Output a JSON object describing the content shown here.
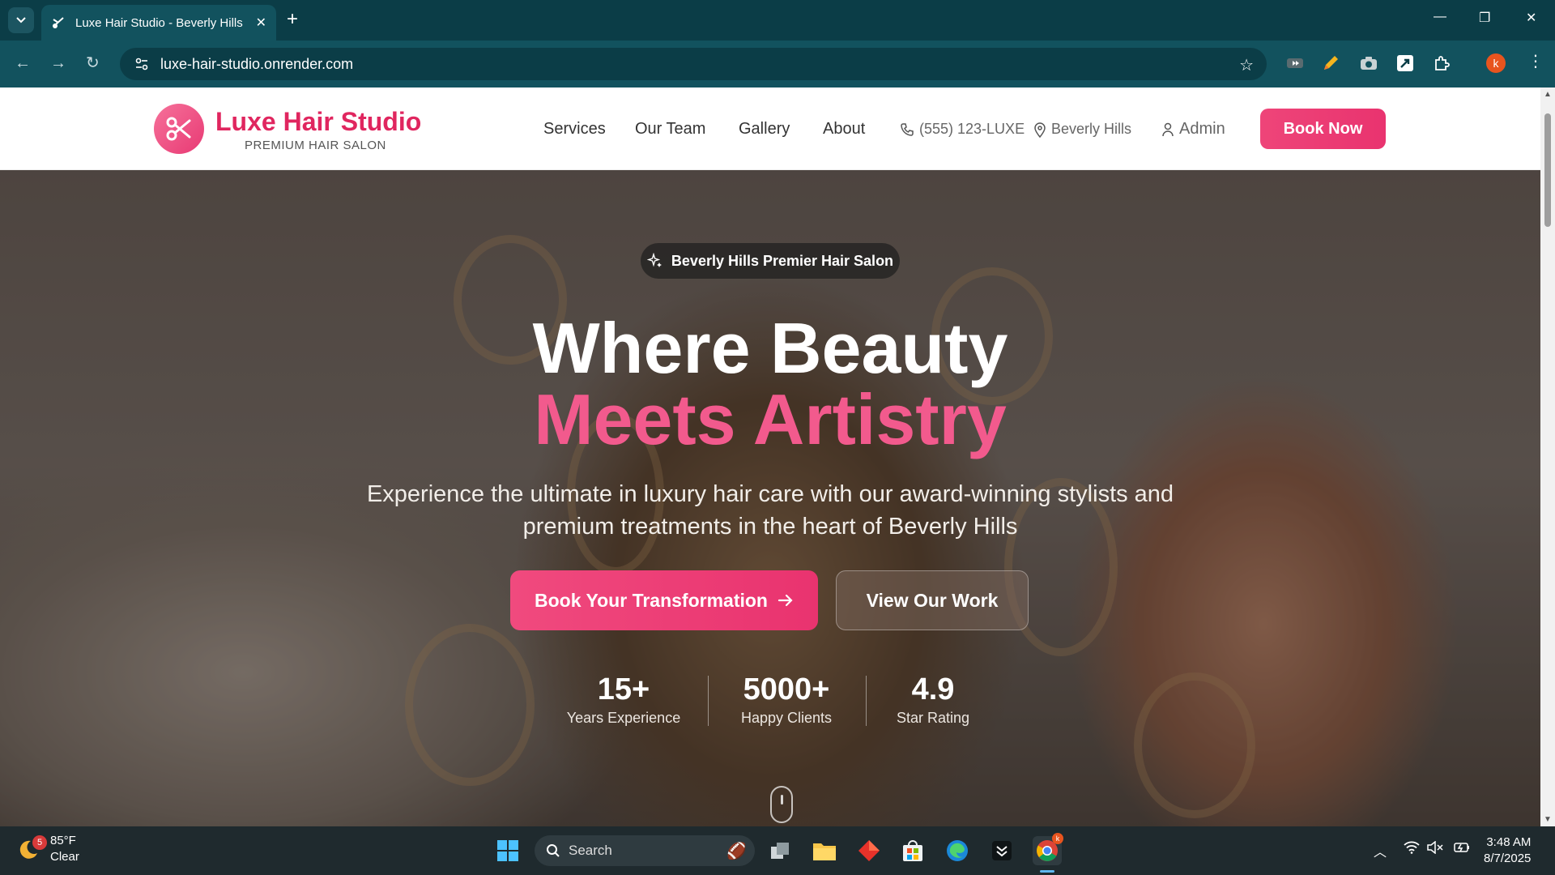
{
  "browser": {
    "tab_title": "Luxe Hair Studio - Beverly Hills",
    "url": "luxe-hair-studio.onrender.com",
    "profile_initial": "k",
    "accent": "#0b3d47"
  },
  "site": {
    "logo_name": "Luxe Hair Studio",
    "logo_tagline": "PREMIUM HAIR SALON",
    "nav": {
      "services": "Services",
      "team": "Our Team",
      "gallery": "Gallery",
      "about": "About",
      "phone": "(555) 123-LUXE",
      "location": "Beverly Hills",
      "admin": "Admin",
      "book_now": "Book Now"
    },
    "brand_color": "#e9336f"
  },
  "hero": {
    "badge": "Beverly Hills Premier Hair Salon",
    "headline_line1": "Where Beauty",
    "headline_line2": "Meets Artistry",
    "subtitle": "Experience the ultimate in luxury hair care with our award-winning stylists and premium treatments in the heart of Beverly Hills",
    "cta_primary": "Book Your Transformation",
    "cta_secondary": "View Our Work",
    "stats": [
      {
        "value": "15+",
        "label": "Years Experience"
      },
      {
        "value": "5000+",
        "label": "Happy Clients"
      },
      {
        "value": "4.9",
        "label": "Star Rating"
      }
    ]
  },
  "taskbar": {
    "weather_temp": "85°F",
    "weather_cond": "Clear",
    "weather_badge": "5",
    "search_label": "Search",
    "time": "3:48 AM",
    "date": "8/7/2025"
  }
}
